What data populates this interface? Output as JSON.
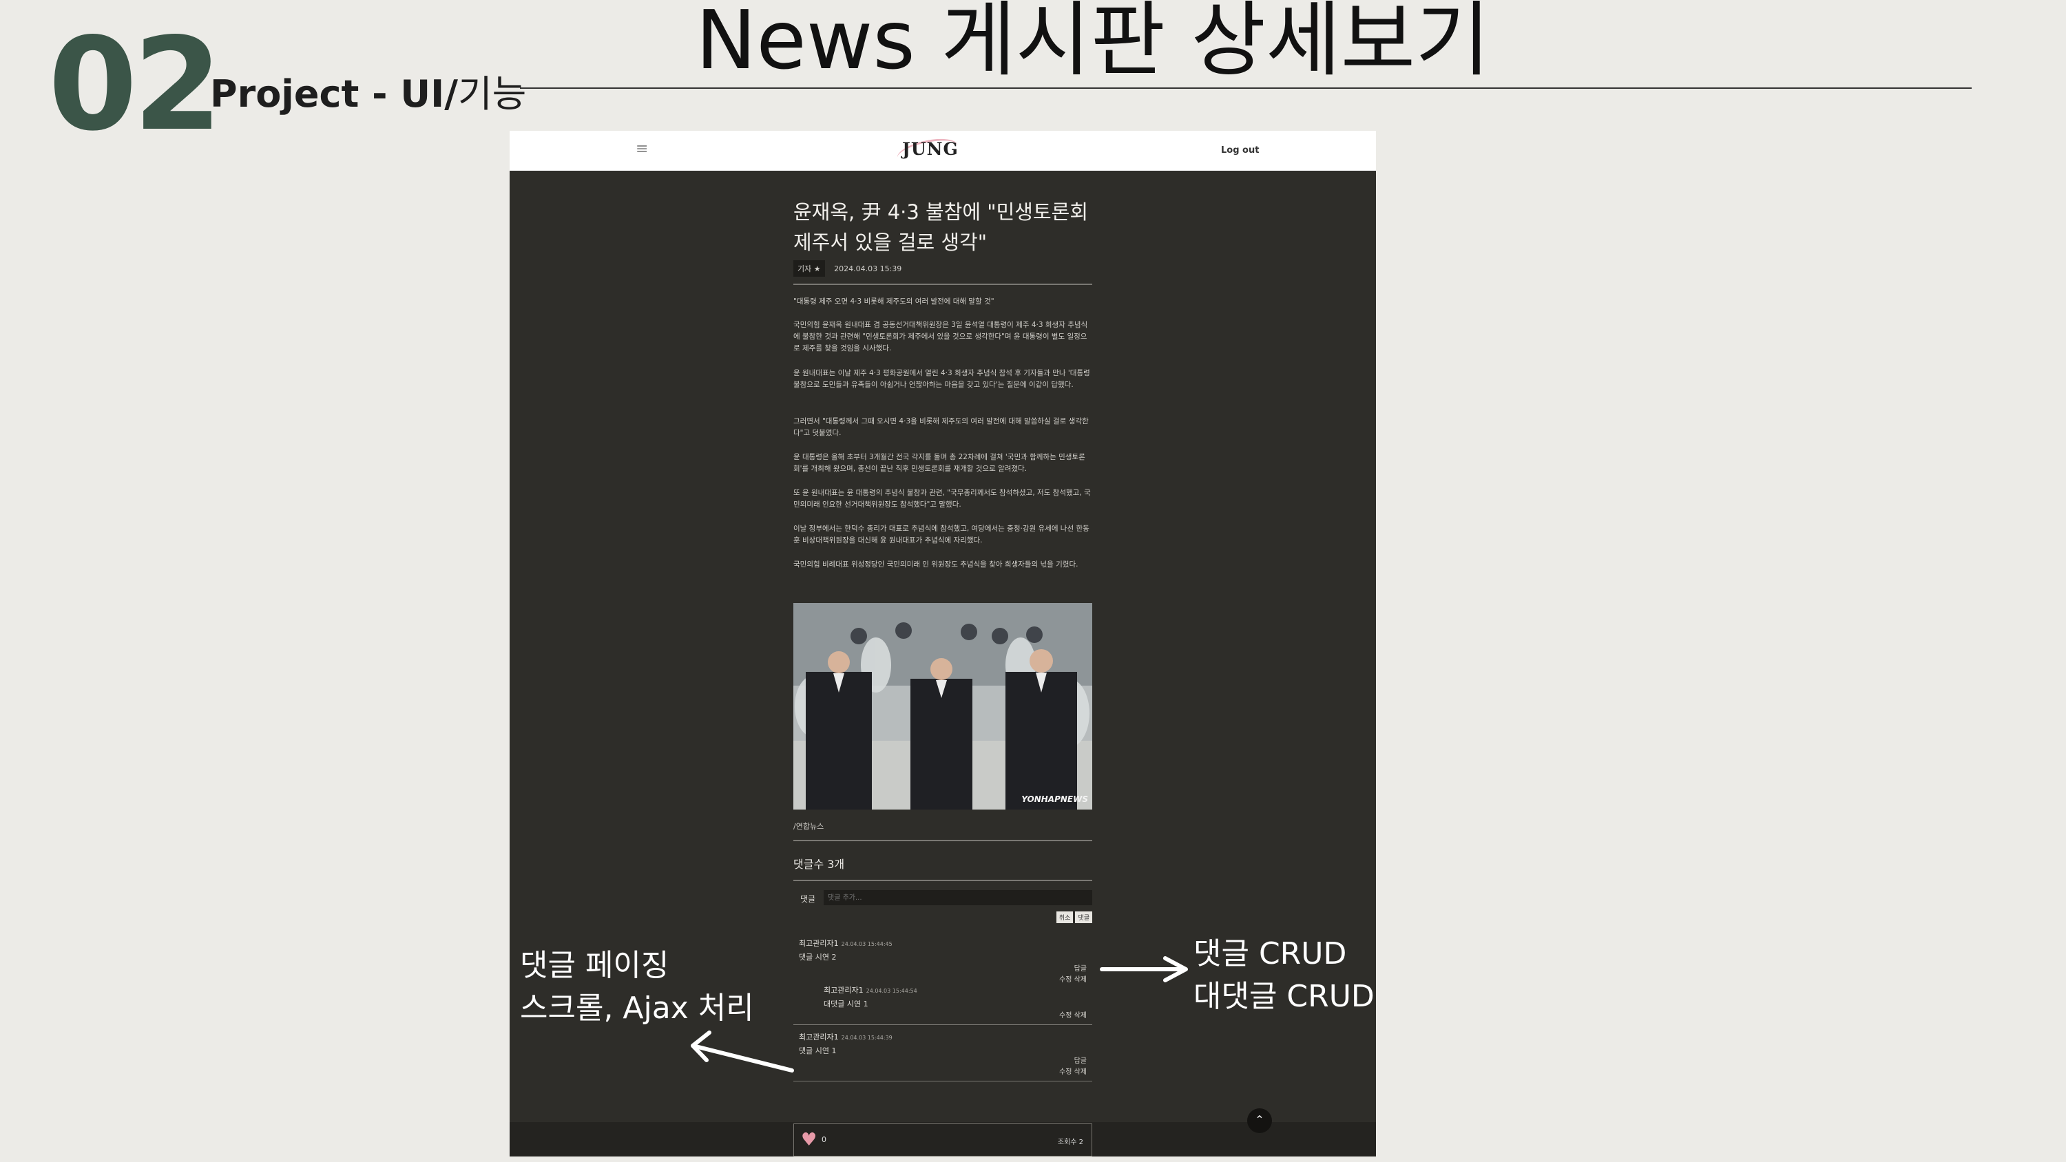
{
  "slide": {
    "number": "02",
    "subtitle_bold": "Project - UI/",
    "subtitle_rest": "기능",
    "title": "News 게시판 상세보기"
  },
  "app": {
    "menu_icon": "≡",
    "logo": "JUNG",
    "logout": "Log out"
  },
  "article": {
    "headline": "윤재옥, 尹 4·3 불참에 \"민생토론회 제주서 있을 걸로 생각\"",
    "reporter_tag": "기자 ★",
    "datetime": "2024.04.03 15:39",
    "paragraphs": [
      "\"대통령 제주 오면 4·3 비롯해 제주도의 여러 발전에 대해 말할 것\"",
      "국민의힘 윤재옥 원내대표 겸 공동선거대책위원장은 3일 윤석열 대통령이 제주 4·3 희생자 추념식에 불참한 것과 관련해 \"민생토론회가 제주에서 있을 것으로 생각한다\"며 윤 대통령이 별도 일정으로 제주를 찾을 것임을 시사했다.",
      "윤 원내대표는 이날 제주 4·3 평화공원에서 열린 4·3 희생자 추념식 참석 후 기자들과 만나 '대통령 불참으로 도민들과 유족들이 아쉽거나 언짢아하는 마음을 갖고 있다'는 질문에 이같이 답했다.",
      "그러면서 \"대통령께서 그때 오시면 4·3을 비롯해 제주도의 여러 발전에 대해 말씀하실 걸로 생각한다\"고 덧붙였다.",
      "윤 대통령은 올해 초부터 3개월간 전국 각지를 돌며 총 22차례에 걸쳐 '국민과 함께하는 민생토론회'를 개최해 왔으며, 총선이 끝난 직후 민생토론회를 재개할 것으로 알려졌다.",
      "또 윤 원내대표는 윤 대통령의 추념식 불참과 관련, \"국무총리께서도 참석하셨고, 저도 참석했고, 국민의미래 인요한 선거대책위원장도 참석했다\"고 말했다.",
      "이날 정부에서는 한덕수 총리가 대표로 추념식에 참석했고, 여당에서는 충청·강원 유세에 나선 한동훈 비상대책위원장을 대신해 윤 원내대표가 추념식에 자리했다.",
      "국민의힘 비례대표 위성정당인 국민의미래 인 위원장도 추념식을 찾아 희생자들의 넋을 기렸다."
    ],
    "photo_watermark": "YONHAPNEWS",
    "photo_credit": "/연합뉴스"
  },
  "comments": {
    "count_label": "댓글수 3개",
    "input_label": "댓글",
    "input_placeholder": "댓글 추가...",
    "cancel_label": "취소",
    "submit_label": "댓글",
    "items": [
      {
        "author": "최고관리자1",
        "time": "24.04.03 15:44:45",
        "text": "댓글 시연 2",
        "reply": "답글",
        "actions": "수정 삭제"
      },
      {
        "author": "최고관리자1",
        "time": "24.04.03 15:44:54",
        "text": "대댓글 시연 1",
        "actions": "수정 삭제"
      },
      {
        "author": "최고관리자1",
        "time": "24.04.03 15:44:39",
        "text": "댓글 시연 1",
        "reply": "답글",
        "actions": "수정 삭제"
      }
    ]
  },
  "footer": {
    "likes": "0",
    "views": "조회수 2",
    "top_icon": "⌃"
  },
  "annotations": {
    "left_line1": "댓글 페이징",
    "left_line2": "스크롤, Ajax 처리",
    "right_line1": "댓글 CRUD",
    "right_line2": "대댓글 CRUD"
  },
  "colors": {
    "accent_green": "#3b5548",
    "page_bg": "#2e2d29",
    "heart": "#e79aa8"
  }
}
